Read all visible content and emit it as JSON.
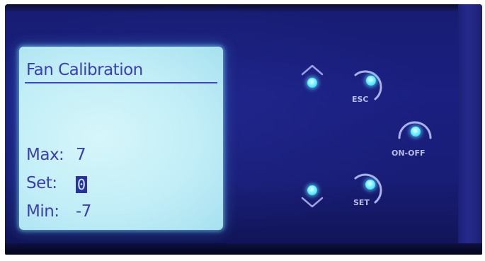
{
  "lcd": {
    "title": "Fan Calibration",
    "rows": [
      {
        "label": "Max:",
        "value": "7"
      },
      {
        "label": "Set:",
        "value": "0"
      },
      {
        "label": "Min:",
        "value": "-7"
      }
    ]
  },
  "buttons": {
    "esc_label": "ESC",
    "on_off_label": "ON-OFF",
    "set_label": "SET"
  },
  "colors": {
    "panel": "#1a1f80",
    "lcd_background": "#c2eef7",
    "lcd_text": "#3a3fb8",
    "led": "#6ff3ff"
  }
}
